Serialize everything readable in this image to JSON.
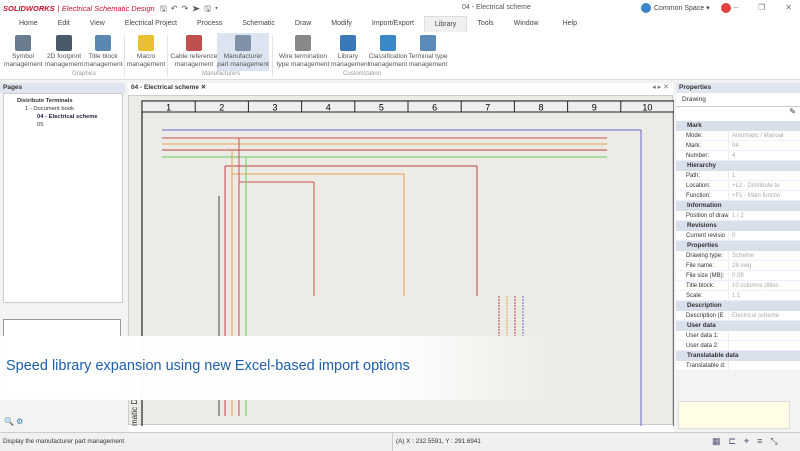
{
  "titlebar": {
    "brand": "SOLIDWORKS",
    "app": "| Electrical Schematic Design",
    "document": "04 - Electrical scheme",
    "space": "Common Space ▾"
  },
  "menu": [
    "Home",
    "Edit",
    "View",
    "Electrical Project",
    "Process",
    "Schematic",
    "Draw",
    "Modify",
    "Import/Export",
    "Library",
    "Tools",
    "Window",
    "Help"
  ],
  "ribbon": {
    "buttons": [
      {
        "l1": "Symbol",
        "l2": "management"
      },
      {
        "l1": "2D footprint",
        "l2": "management"
      },
      {
        "l1": "Title block",
        "l2": "management"
      },
      {
        "l1": "Macro",
        "l2": "management"
      },
      {
        "l1": "Cable reference",
        "l2": "management"
      },
      {
        "l1": "Manufacturer",
        "l2": "part management"
      },
      {
        "l1": "Wire termination",
        "l2": "type management"
      },
      {
        "l1": "Library",
        "l2": "management"
      },
      {
        "l1": "Classification",
        "l2": "management"
      },
      {
        "l1": "Terminal type",
        "l2": "management"
      }
    ],
    "groups": [
      "Graphics",
      "Manufacturers",
      "Customization"
    ]
  },
  "pages": {
    "title": "Pages",
    "tree": [
      "Distribute Terminals",
      "1 - Document book",
      "04 - Electrical scheme",
      "05"
    ]
  },
  "drawing": {
    "tab": "04 - Electrical scheme",
    "columns": [
      "1",
      "2",
      "3",
      "4",
      "5",
      "6",
      "7",
      "8",
      "9",
      "10"
    ],
    "side_label": "matic De"
  },
  "properties": {
    "title": "Properties",
    "tab": "Drawing",
    "sections": [
      {
        "name": "Mark",
        "rows": [
          [
            "Mode:",
            "Automatic / Manual"
          ],
          [
            "Mark:",
            "04"
          ],
          [
            "Number:",
            "4"
          ]
        ]
      },
      {
        "name": "Hierarchy",
        "rows": [
          [
            "Path:",
            "1"
          ],
          [
            "Location:",
            "+L2 - Distribute te"
          ],
          [
            "Function:",
            "+F1 - Main functio"
          ]
        ]
      },
      {
        "name": "Information",
        "rows": [
          [
            "Position of drawin",
            "1 / 2"
          ]
        ]
      },
      {
        "name": "Revisions",
        "rows": [
          [
            "Current revisio",
            "0"
          ]
        ]
      },
      {
        "name": "Properties",
        "rows": [
          [
            "Drawing type:",
            "Scheme"
          ],
          [
            "File name:",
            "28.ewg"
          ],
          [
            "File size (MB):",
            "0.09"
          ],
          [
            "Title block:",
            "10 columns (titles"
          ],
          [
            "Scale:",
            "1:1"
          ]
        ]
      },
      {
        "name": "Description",
        "rows": [
          [
            "Description (E",
            "Electrical scheme"
          ]
        ]
      },
      {
        "name": "User data",
        "rows": [
          [
            "User data 1:",
            ""
          ],
          [
            "User data 2:",
            ""
          ]
        ]
      },
      {
        "name": "Translatable data",
        "rows": [
          [
            "Translatable d:",
            ""
          ]
        ]
      }
    ]
  },
  "status": {
    "hint": "Display the manufacturer part management",
    "coords": "(A) X : 232.5591, Y : 291.6941"
  },
  "banner": "Speed library expansion using new Excel-based import options",
  "colors": {
    "brand": "#c8102e",
    "accent": "#1e5fa8"
  }
}
